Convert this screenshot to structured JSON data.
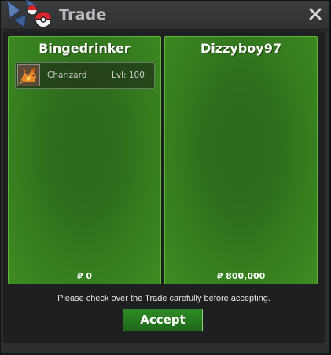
{
  "window": {
    "title": "Trade",
    "close_icon": "close-icon"
  },
  "left_trader": {
    "name": "Bingedrinker",
    "items": [
      {
        "name": "Charizard",
        "level": "Lvl: 100",
        "icon": "charizard-icon"
      }
    ],
    "money": "₽ 0"
  },
  "right_trader": {
    "name": "Dizzyboy97",
    "items": [],
    "money": "₽ 800,000"
  },
  "footer": {
    "notice": "Please check over the Trade carefully before accepting.",
    "accept_label": "Accept"
  },
  "colors": {
    "panel_green": "#3d8c21",
    "accept_green": "#2e8a25",
    "title_text": "#b9bcbf"
  }
}
